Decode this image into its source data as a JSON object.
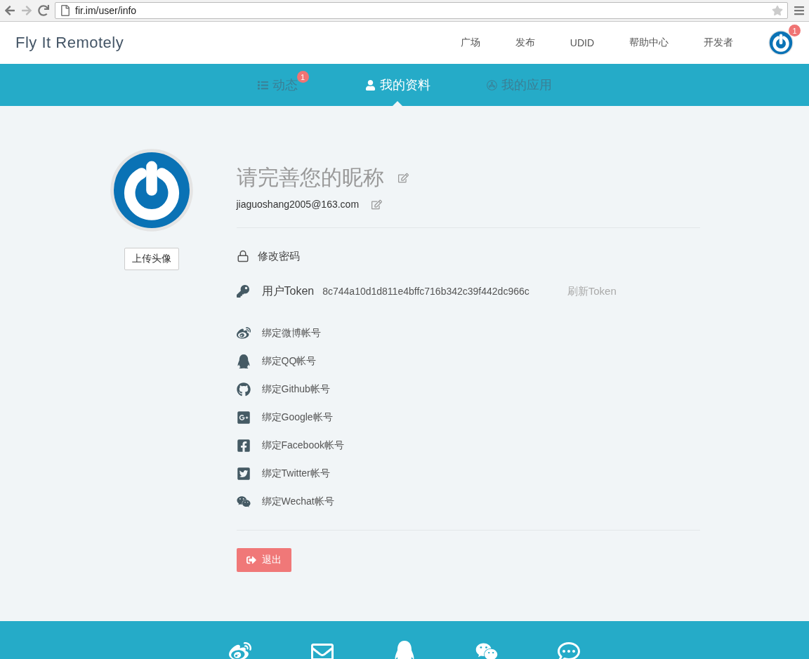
{
  "browser": {
    "url": "fir.im/user/info"
  },
  "header": {
    "brand": "Fly It Remotely",
    "nav": [
      "广场",
      "发布",
      "UDID",
      "帮助中心",
      "开发者"
    ],
    "notification_count": "1"
  },
  "tabs": [
    {
      "label": "动态",
      "selected": false,
      "kind": "list",
      "badge": "1"
    },
    {
      "label": "我的资料",
      "selected": true,
      "kind": "user"
    },
    {
      "label": "我的应用",
      "selected": false,
      "kind": "apps"
    }
  ],
  "profile": {
    "upload_button": "上传头像",
    "nickname": "请完善您的昵称",
    "email": "jiaguoshang2005@163.com"
  },
  "change_password": "修改密码",
  "token": {
    "label": "用户Token",
    "value": "8c744a10d1d811e4bffc716b342c39f442dc966c",
    "refresh": "刷新Token"
  },
  "bindings": [
    {
      "kind": "weibo",
      "label": "绑定微博帐号"
    },
    {
      "kind": "qq",
      "label": "绑定QQ帐号"
    },
    {
      "kind": "github",
      "label": "绑定Github帐号"
    },
    {
      "kind": "google",
      "label": "绑定Google帐号"
    },
    {
      "kind": "facebook",
      "label": "绑定Facebook帐号"
    },
    {
      "kind": "twitter",
      "label": "绑定Twitter帐号"
    },
    {
      "kind": "wechat",
      "label": "绑定Wechat帐号"
    }
  ],
  "logout_button": "退出"
}
